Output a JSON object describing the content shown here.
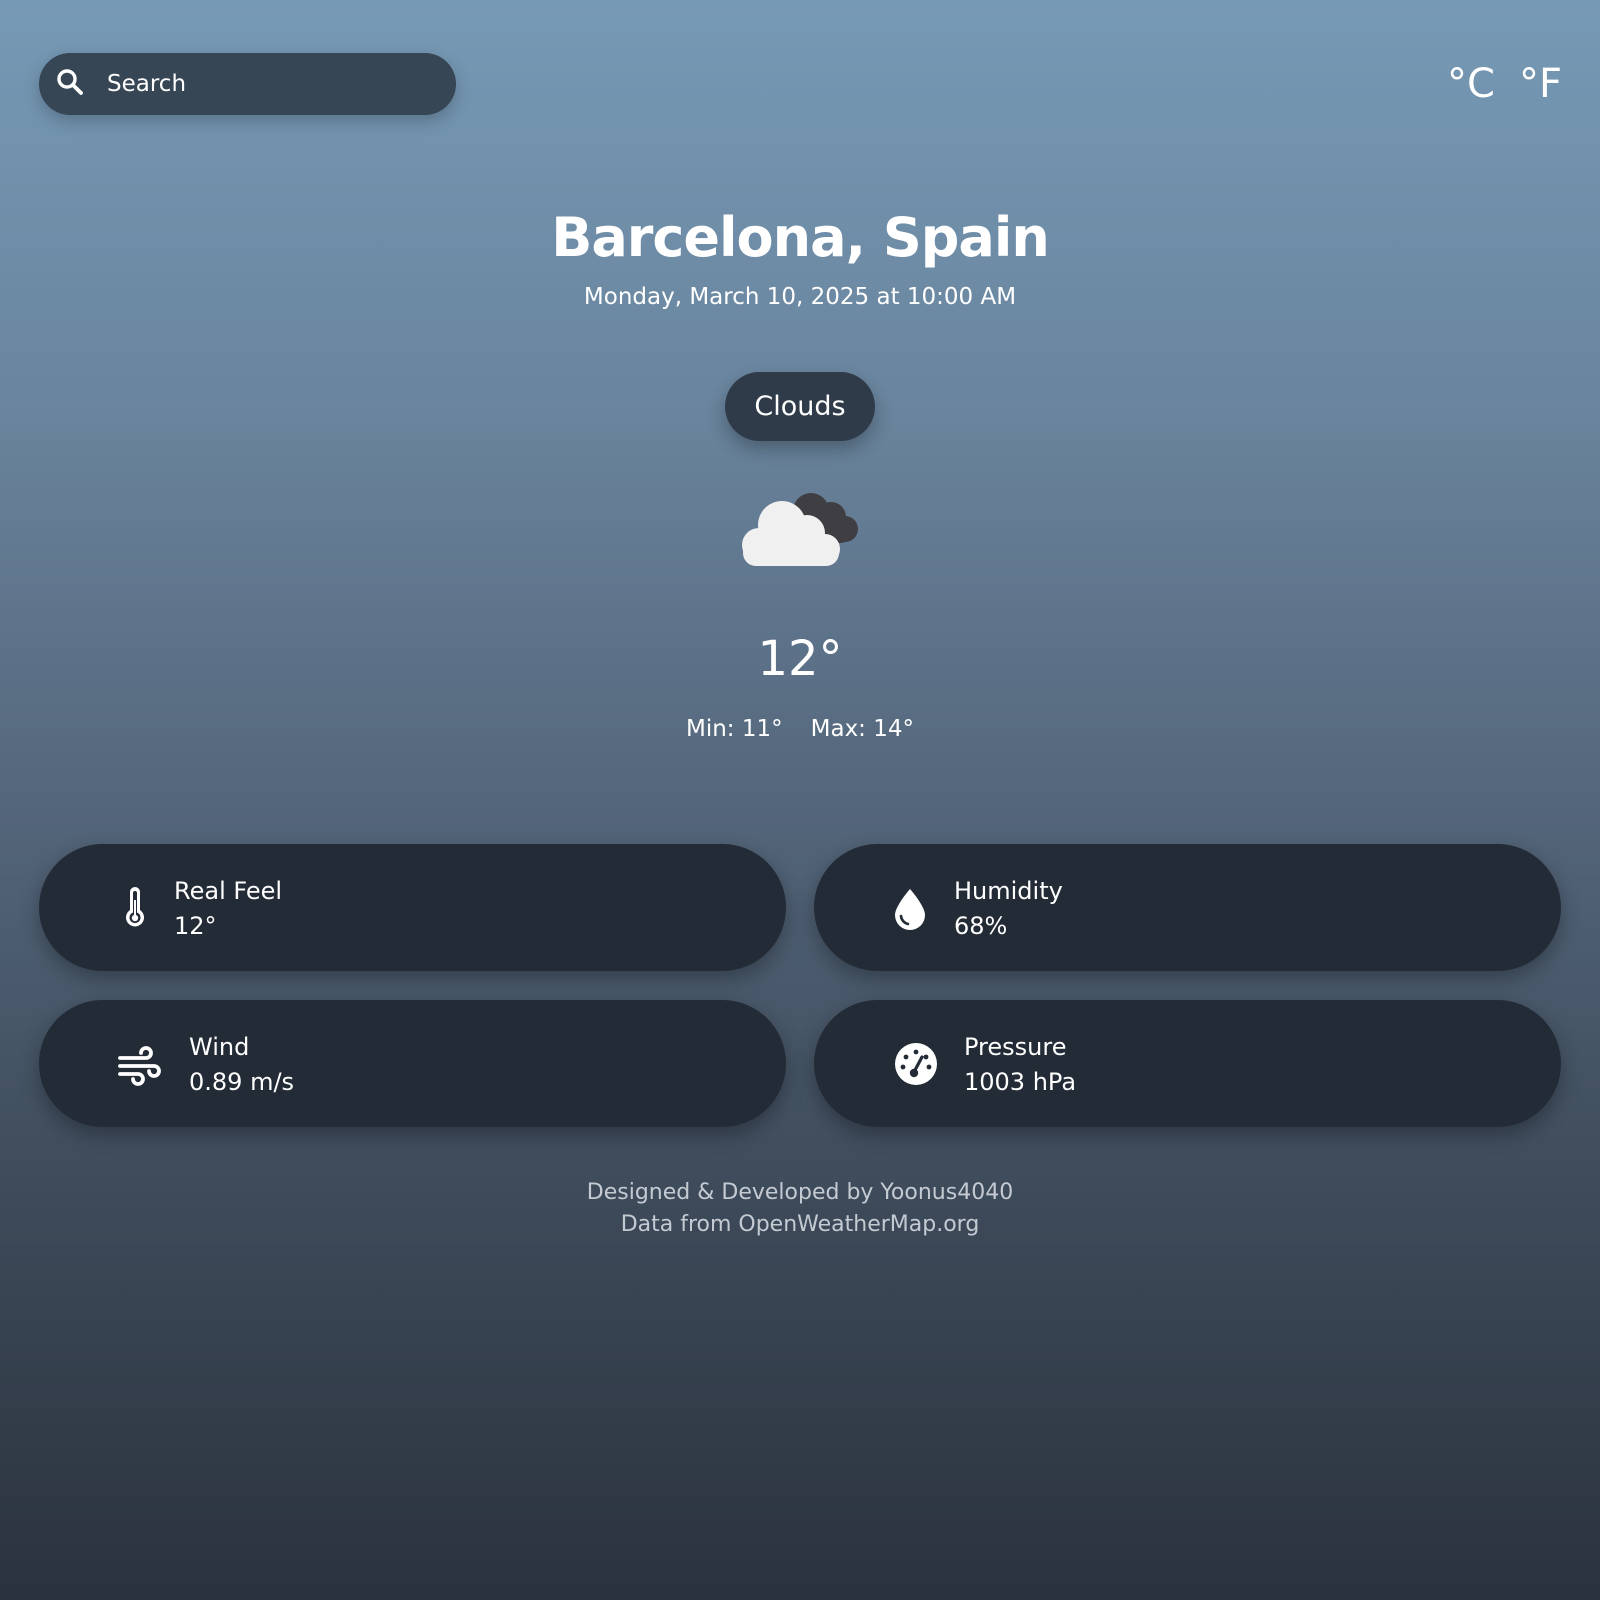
{
  "search": {
    "placeholder": "Search"
  },
  "units": {
    "celsius": "°C",
    "fahrenheit": "°F"
  },
  "location": {
    "city": "Barcelona, Spain",
    "datetime": "Monday, March 10, 2025 at 10:00 AM"
  },
  "current": {
    "condition": "Clouds",
    "icon": "clouds-icon",
    "temperature": "12°",
    "min": "Min: 11°",
    "max": "Max: 14°"
  },
  "stats": {
    "real_feel": {
      "label": "Real Feel",
      "value": "12°",
      "icon": "thermometer-icon"
    },
    "humidity": {
      "label": "Humidity",
      "value": "68%",
      "icon": "water-drop-icon"
    },
    "wind": {
      "label": "Wind",
      "value": "0.89 m/s",
      "icon": "wind-icon"
    },
    "pressure": {
      "label": "Pressure",
      "value": "1003 hPa",
      "icon": "gauge-icon"
    }
  },
  "footer": {
    "credit": "Designed & Developed by Yoonus4040",
    "source": "Data from OpenWeatherMap.org"
  },
  "colors": {
    "background_top": "#7699b5",
    "background_bottom": "#2a323d",
    "search_bg": "#374655",
    "badge_bg": "#2f3b48",
    "card_bg": "#232b36",
    "text": "#ffffff",
    "footer_text": "#c4cad2"
  }
}
